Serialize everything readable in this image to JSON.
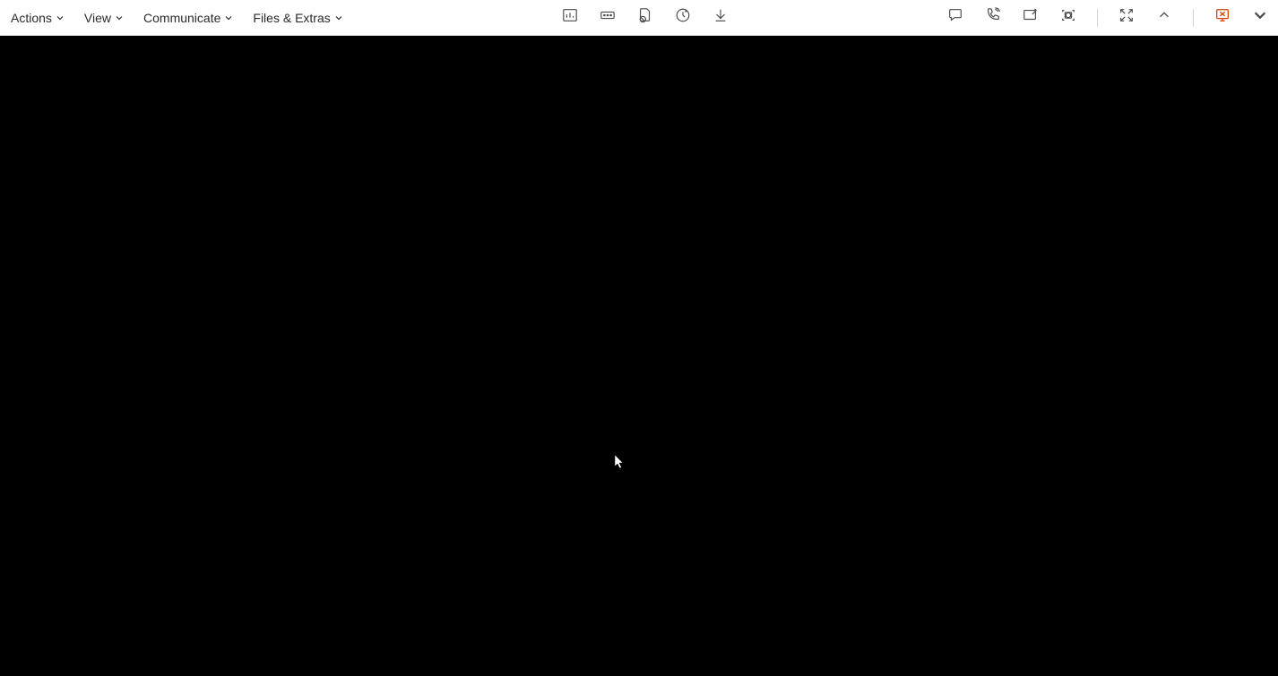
{
  "menus": {
    "actions": "Actions",
    "view": "View",
    "communicate": "Communicate",
    "files_extras": "Files & Extras"
  }
}
